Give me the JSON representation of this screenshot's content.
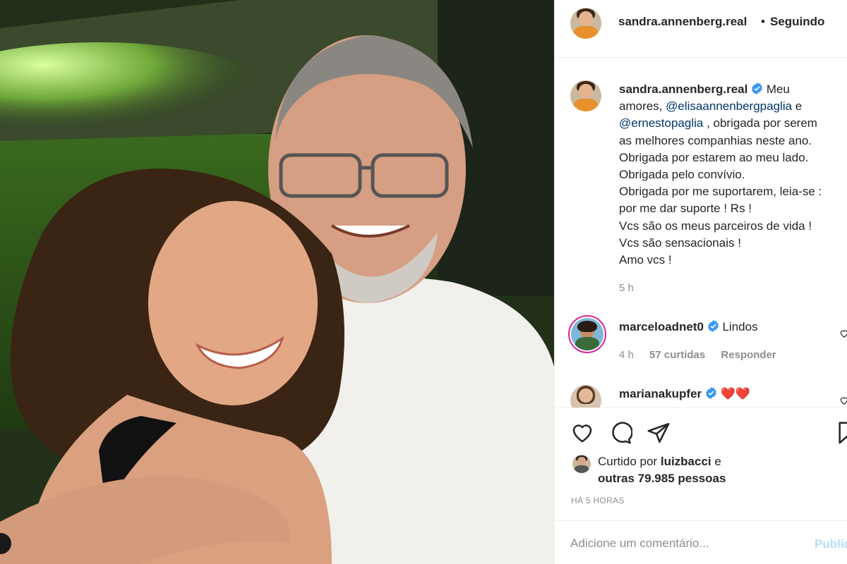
{
  "post": {
    "author": "sandra.annenberg.real",
    "follow_status": "Seguindo",
    "separator": "•"
  },
  "caption": {
    "username": "sandra.annenberg.real",
    "lines": [
      "Meu",
      "amores,",
      "@elisaannenbergpaglia",
      "e",
      "@ernestopaglia",
      ", obrigada por serem",
      "as melhores companhias neste ano.",
      "Obrigada por estarem ao meu lado.",
      "Obrigada pelo convívio.",
      "Obrigada por me suportarem, leia-se :",
      "por me dar suporte ! Rs !",
      "Vcs são os meus parceiros de vida !",
      "Vcs são sensacionais !",
      "Amo vcs !"
    ],
    "time": "5 h"
  },
  "comments": [
    {
      "username": "marceloadnet0",
      "text": "Lindos",
      "time": "4 h",
      "likes": "57 curtidas",
      "reply": "Responder"
    },
    {
      "username": "marianakupfer",
      "text": "❤️❤️"
    }
  ],
  "actions": {
    "like_icon": "heart-icon",
    "comment_icon": "comment-icon",
    "share_icon": "send-icon",
    "save_icon": "bookmark-icon"
  },
  "likes": {
    "prefix": "Curtido por",
    "user": "luizbacci",
    "suffix": "e",
    "others": "outras 79.985 pessoas"
  },
  "post_age": "HÁ 5 HORAS",
  "composer": {
    "placeholder": "Adicione um comentário...",
    "publish_label": "Publicar"
  },
  "colors": {
    "text": "#262626",
    "muted": "#8e8e8e",
    "mention": "#00376b",
    "verified": "#3897f0",
    "publish_disabled": "#b2dffc",
    "heart_red": "#ed4956"
  }
}
